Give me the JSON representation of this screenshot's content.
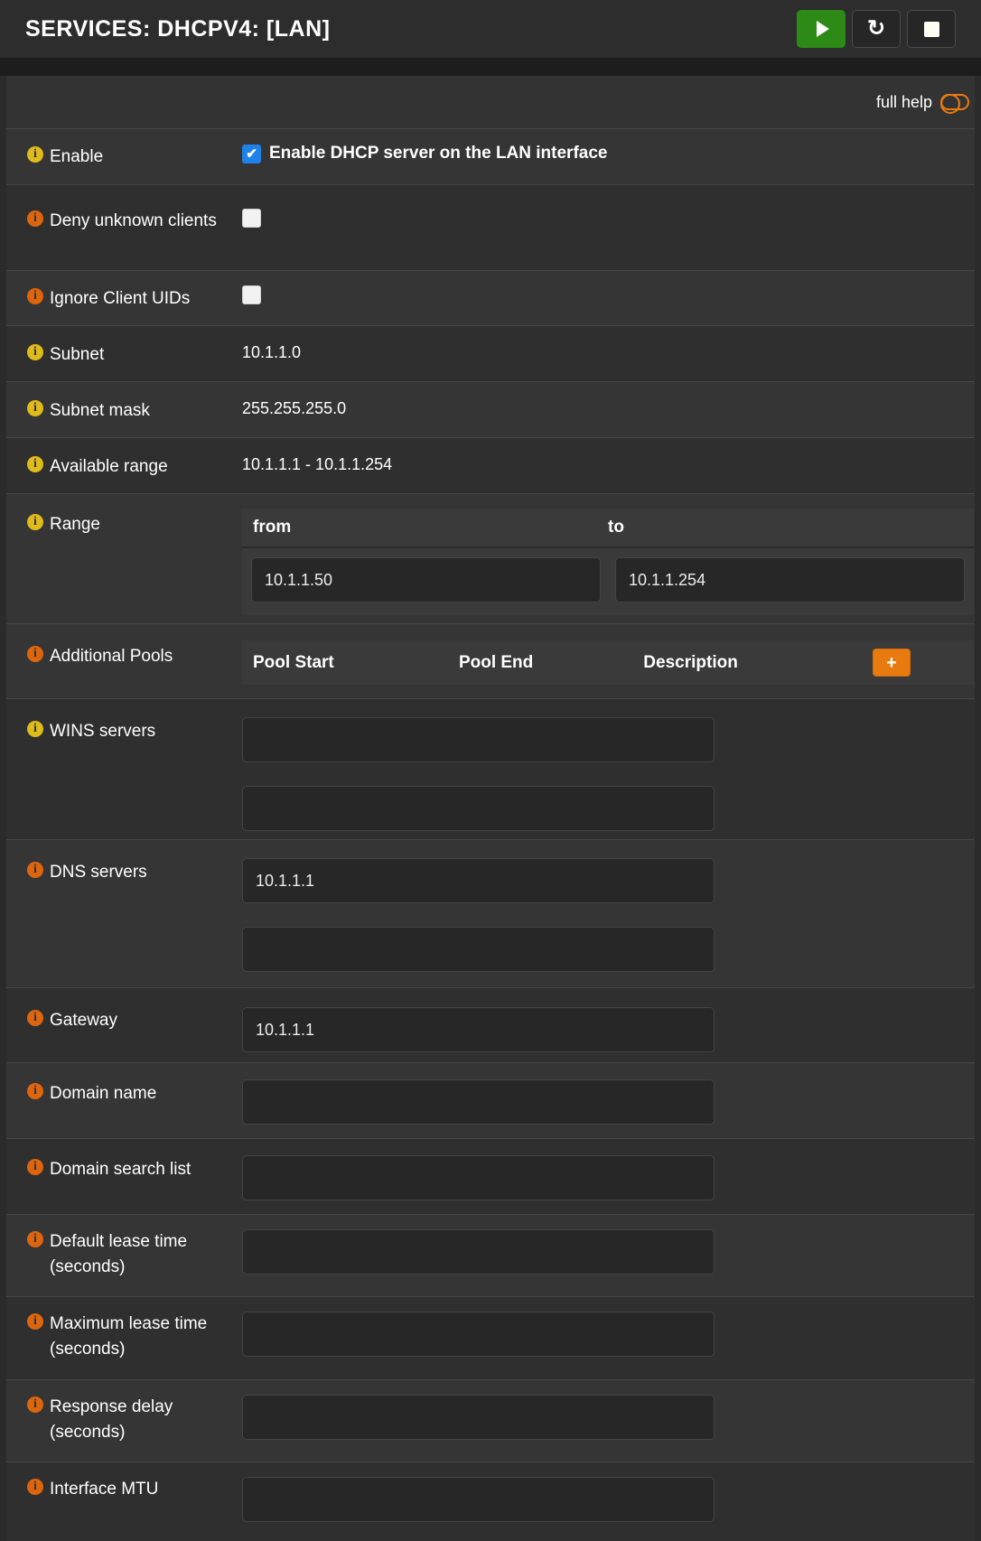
{
  "header": {
    "title": "SERVICES: DHCPV4: [LAN]",
    "buttons": [
      {
        "id": "apply",
        "icon": "play-icon"
      },
      {
        "id": "refresh",
        "icon": "refresh-icon"
      },
      {
        "id": "stop",
        "icon": "stop-icon"
      }
    ]
  },
  "help": {
    "label": "full help"
  },
  "colors": {
    "accent_orange": "#e87a10",
    "accent_green": "#2d8a17",
    "info_icon_yellow": "#dfba1b",
    "info_icon_orange": "#dd650e",
    "checkbox_checked_blue": "#1e82e8"
  },
  "form": {
    "rows": [
      {
        "label": "Enable",
        "icon": "yellow",
        "type": "checkbox",
        "checked": true,
        "checkbox_label": "Enable DHCP server on the LAN interface"
      },
      {
        "label": "Deny unknown clients",
        "icon": "orange",
        "type": "checkbox",
        "checked": false
      },
      {
        "label": "Ignore Client UIDs",
        "icon": "orange",
        "type": "checkbox",
        "checked": false
      },
      {
        "label": "Subnet",
        "icon": "yellow",
        "type": "static",
        "value": "10.1.1.0"
      },
      {
        "label": "Subnet mask",
        "icon": "yellow",
        "type": "static",
        "value": "255.255.255.0"
      },
      {
        "label": "Available range",
        "icon": "yellow",
        "type": "static",
        "value": "10.1.1.1 - 10.1.1.254"
      },
      {
        "label": "Range",
        "icon": "yellow",
        "type": "range",
        "from_header": "from",
        "to_header": "to",
        "from_value": "10.1.1.50",
        "to_value": "10.1.1.254"
      },
      {
        "label": "Additional Pools",
        "icon": "orange",
        "type": "pools",
        "headers": [
          "Pool Start",
          "Pool End",
          "Description"
        ],
        "add_label": "+"
      },
      {
        "label": "WINS servers",
        "icon": "yellow",
        "type": "double-input",
        "values": [
          "",
          ""
        ]
      },
      {
        "label": "DNS servers",
        "icon": "orange",
        "type": "double-input",
        "values": [
          "10.1.1.1",
          ""
        ]
      },
      {
        "label": "Gateway",
        "icon": "orange",
        "type": "input",
        "value": "10.1.1.1"
      },
      {
        "label": "Domain name",
        "icon": "orange",
        "type": "input",
        "value": ""
      },
      {
        "label": "Domain search list",
        "icon": "orange",
        "type": "input",
        "value": ""
      },
      {
        "label": "Default lease time (seconds)",
        "icon": "orange",
        "type": "input",
        "value": ""
      },
      {
        "label": "Maximum lease time (seconds)",
        "icon": "orange",
        "type": "input",
        "value": ""
      },
      {
        "label": "Response delay (seconds)",
        "icon": "orange",
        "type": "input",
        "value": ""
      },
      {
        "label": "Interface MTU",
        "icon": "orange",
        "type": "input",
        "value": ""
      }
    ]
  }
}
